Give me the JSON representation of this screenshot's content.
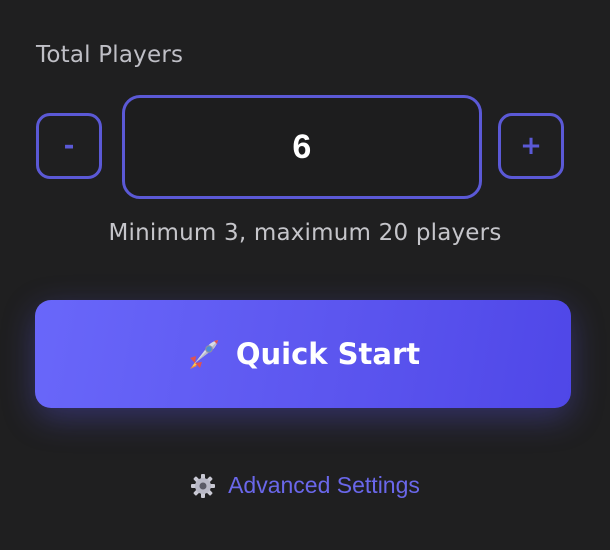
{
  "players": {
    "label": "Total Players",
    "value": "6",
    "minus_label": "-",
    "plus_label": "+",
    "hint": "Minimum 3, maximum 20 players"
  },
  "actions": {
    "quick_start_label": "Quick Start",
    "quick_start_icon": "rocket-icon",
    "advanced_label": "Advanced Settings",
    "advanced_icon": "gear-icon"
  },
  "colors": {
    "background": "#1f1f20",
    "accent": "#5b59d6",
    "button_gradient_start": "#6967fa",
    "button_gradient_end": "#4f47e8",
    "link": "#6a67ea"
  }
}
